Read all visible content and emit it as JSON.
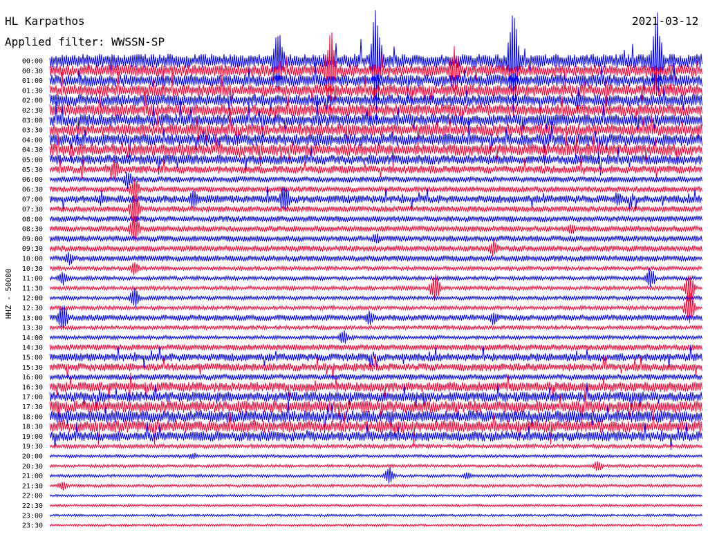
{
  "header": {
    "station": "HL Karpathos",
    "date": "2021-03-12",
    "filter": "Applied filter: WWSSN-SP"
  },
  "chart_data": {
    "type": "line",
    "title": "HL Karpathos",
    "date": "2021-03-12",
    "subtitle": "Applied filter: WWSSN-SP",
    "ylabel": "HHZ - 50000",
    "xlabel": "",
    "row_interval_minutes": 30,
    "colors": [
      "#0000ff",
      "#ff0033"
    ],
    "color_pattern": "alternating blue / red per 30-minute row",
    "y_tick_labels": [
      "00:00",
      "00:30",
      "01:00",
      "01:30",
      "02:00",
      "02:30",
      "03:00",
      "03:30",
      "04:00",
      "04:30",
      "05:00",
      "05:30",
      "06:00",
      "06:30",
      "07:00",
      "07:30",
      "08:00",
      "08:30",
      "09:00",
      "09:30",
      "10:00",
      "10:30",
      "11:00",
      "11:30",
      "12:00",
      "12:30",
      "13:00",
      "13:30",
      "14:00",
      "14:30",
      "15:00",
      "15:30",
      "16:00",
      "16:30",
      "17:00",
      "17:30",
      "18:00",
      "18:30",
      "19:00",
      "19:30",
      "20:00",
      "20:30",
      "21:00",
      "21:30",
      "22:00",
      "22:30",
      "23:00",
      "23:30"
    ],
    "rows": [
      {
        "label": "00:00",
        "color": "#0000ff",
        "amplitude": 7,
        "events": [
          {
            "pos": 0.35,
            "amp": 60
          },
          {
            "pos": 0.5,
            "amp": 90
          },
          {
            "pos": 0.71,
            "amp": 85
          },
          {
            "pos": 0.93,
            "amp": 80
          }
        ]
      },
      {
        "label": "00:30",
        "color": "#ff0033",
        "amplitude": 6,
        "events": [
          {
            "pos": 0.43,
            "amp": 70
          },
          {
            "pos": 0.62,
            "amp": 40
          }
        ]
      },
      {
        "label": "01:00",
        "color": "#0000ff",
        "amplitude": 6,
        "events": []
      },
      {
        "label": "01:30",
        "color": "#ff0033",
        "amplitude": 6,
        "events": []
      },
      {
        "label": "02:00",
        "color": "#0000ff",
        "amplitude": 6,
        "events": []
      },
      {
        "label": "02:30",
        "color": "#ff0033",
        "amplitude": 6,
        "events": []
      },
      {
        "label": "03:00",
        "color": "#0000ff",
        "amplitude": 6,
        "events": []
      },
      {
        "label": "03:30",
        "color": "#ff0033",
        "amplitude": 6,
        "events": []
      },
      {
        "label": "04:00",
        "color": "#0000ff",
        "amplitude": 6,
        "events": []
      },
      {
        "label": "04:30",
        "color": "#ff0033",
        "amplitude": 6,
        "events": []
      },
      {
        "label": "05:00",
        "color": "#0000ff",
        "amplitude": 5,
        "events": []
      },
      {
        "label": "05:30",
        "color": "#ff0033",
        "amplitude": 4,
        "events": [
          {
            "pos": 0.1,
            "amp": 18
          }
        ]
      },
      {
        "label": "06:00",
        "color": "#0000ff",
        "amplitude": 3,
        "events": [
          {
            "pos": 0.12,
            "amp": 15
          }
        ]
      },
      {
        "label": "06:30",
        "color": "#ff0033",
        "amplitude": 3,
        "events": [
          {
            "pos": 0.13,
            "amp": 22
          }
        ]
      },
      {
        "label": "07:00",
        "color": "#0000ff",
        "amplitude": 4,
        "events": [
          {
            "pos": 0.22,
            "amp": 16
          },
          {
            "pos": 0.36,
            "amp": 25
          },
          {
            "pos": 0.87,
            "amp": 12
          }
        ]
      },
      {
        "label": "07:30",
        "color": "#ff0033",
        "amplitude": 3,
        "events": [
          {
            "pos": 0.13,
            "amp": 30
          }
        ]
      },
      {
        "label": "08:00",
        "color": "#0000ff",
        "amplitude": 3,
        "events": []
      },
      {
        "label": "08:30",
        "color": "#ff0033",
        "amplitude": 3,
        "events": [
          {
            "pos": 0.13,
            "amp": 25
          },
          {
            "pos": 0.8,
            "amp": 10
          }
        ]
      },
      {
        "label": "09:00",
        "color": "#0000ff",
        "amplitude": 3,
        "events": [
          {
            "pos": 0.5,
            "amp": 10
          }
        ]
      },
      {
        "label": "09:30",
        "color": "#ff0033",
        "amplitude": 3,
        "events": [
          {
            "pos": 0.68,
            "amp": 14
          }
        ]
      },
      {
        "label": "10:00",
        "color": "#0000ff",
        "amplitude": 3,
        "events": [
          {
            "pos": 0.03,
            "amp": 12
          }
        ]
      },
      {
        "label": "10:30",
        "color": "#ff0033",
        "amplitude": 2,
        "events": [
          {
            "pos": 0.13,
            "amp": 12
          }
        ]
      },
      {
        "label": "11:00",
        "color": "#0000ff",
        "amplitude": 2,
        "events": [
          {
            "pos": 0.02,
            "amp": 12
          },
          {
            "pos": 0.92,
            "amp": 18
          }
        ]
      },
      {
        "label": "11:30",
        "color": "#ff0033",
        "amplitude": 2,
        "events": [
          {
            "pos": 0.59,
            "amp": 22
          },
          {
            "pos": 0.98,
            "amp": 26
          }
        ]
      },
      {
        "label": "12:00",
        "color": "#0000ff",
        "amplitude": 2,
        "events": [
          {
            "pos": 0.13,
            "amp": 16
          }
        ]
      },
      {
        "label": "12:30",
        "color": "#ff0033",
        "amplitude": 2,
        "events": [
          {
            "pos": 0.98,
            "amp": 30
          }
        ]
      },
      {
        "label": "13:00",
        "color": "#0000ff",
        "amplitude": 3,
        "events": [
          {
            "pos": 0.02,
            "amp": 25
          },
          {
            "pos": 0.49,
            "amp": 12
          },
          {
            "pos": 0.68,
            "amp": 12
          }
        ]
      },
      {
        "label": "13:30",
        "color": "#ff0033",
        "amplitude": 2,
        "events": []
      },
      {
        "label": "14:00",
        "color": "#0000ff",
        "amplitude": 2,
        "events": [
          {
            "pos": 0.45,
            "amp": 12
          }
        ]
      },
      {
        "label": "14:30",
        "color": "#ff0033",
        "amplitude": 3,
        "events": []
      },
      {
        "label": "15:00",
        "color": "#0000ff",
        "amplitude": 4,
        "events": []
      },
      {
        "label": "15:30",
        "color": "#ff0033",
        "amplitude": 4,
        "events": []
      },
      {
        "label": "16:00",
        "color": "#0000ff",
        "amplitude": 3,
        "events": []
      },
      {
        "label": "16:30",
        "color": "#ff0033",
        "amplitude": 5,
        "events": []
      },
      {
        "label": "17:00",
        "color": "#0000ff",
        "amplitude": 5,
        "events": []
      },
      {
        "label": "17:30",
        "color": "#ff0033",
        "amplitude": 6,
        "events": []
      },
      {
        "label": "18:00",
        "color": "#0000ff",
        "amplitude": 6,
        "events": []
      },
      {
        "label": "18:30",
        "color": "#ff0033",
        "amplitude": 6,
        "events": []
      },
      {
        "label": "19:00",
        "color": "#0000ff",
        "amplitude": 5,
        "events": []
      },
      {
        "label": "19:30",
        "color": "#ff0033",
        "amplitude": 2,
        "events": []
      },
      {
        "label": "20:00",
        "color": "#0000ff",
        "amplitude": 1.5,
        "events": [
          {
            "pos": 0.22,
            "amp": 6
          }
        ]
      },
      {
        "label": "20:30",
        "color": "#ff0033",
        "amplitude": 1.5,
        "events": [
          {
            "pos": 0.84,
            "amp": 10
          }
        ]
      },
      {
        "label": "21:00",
        "color": "#0000ff",
        "amplitude": 1.5,
        "events": [
          {
            "pos": 0.52,
            "amp": 14
          },
          {
            "pos": 0.64,
            "amp": 6
          }
        ]
      },
      {
        "label": "21:30",
        "color": "#ff0033",
        "amplitude": 1.5,
        "events": [
          {
            "pos": 0.02,
            "amp": 8
          }
        ]
      },
      {
        "label": "22:00",
        "color": "#0000ff",
        "amplitude": 1.2,
        "events": []
      },
      {
        "label": "22:30",
        "color": "#ff0033",
        "amplitude": 1.2,
        "events": []
      },
      {
        "label": "23:00",
        "color": "#0000ff",
        "amplitude": 1.2,
        "events": []
      },
      {
        "label": "23:30",
        "color": "#ff0033",
        "amplitude": 1.2,
        "events": []
      }
    ],
    "grid": false,
    "legend": "none"
  }
}
